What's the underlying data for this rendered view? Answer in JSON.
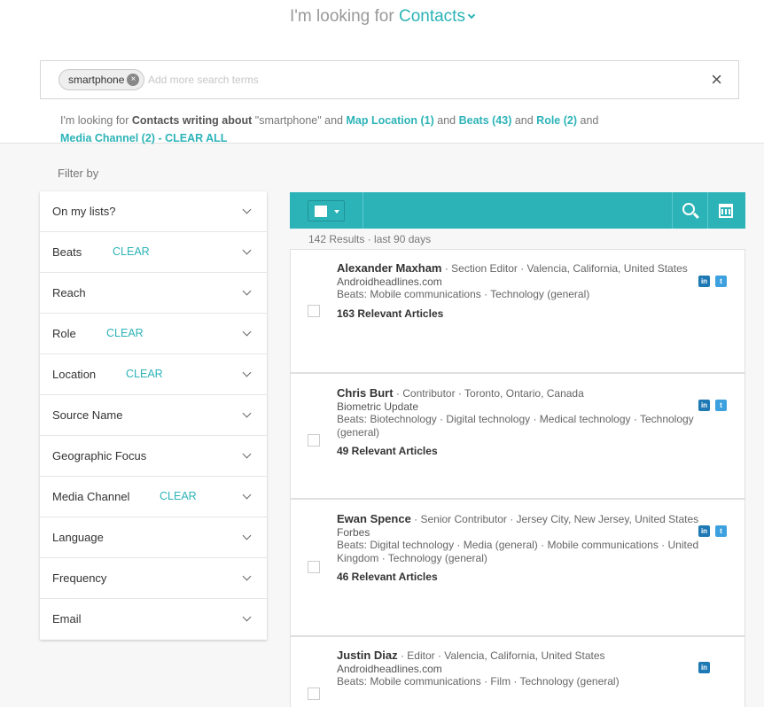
{
  "header": {
    "prefix": "I'm looking for",
    "type": "Contacts"
  },
  "search": {
    "chip": "smartphone",
    "placeholder": "Add more search terms"
  },
  "summary": {
    "t1": "I'm looking for ",
    "t2": "Contacts writing about",
    "t3": " \"smartphone\" and ",
    "l1": "Map Location (1)",
    "t4": " and ",
    "l2": "Beats (43)",
    "t5": " and ",
    "l3": "Role (2)",
    "t6": " and",
    "l4": "Media Channel (2)",
    "t7": " - ",
    "l5": "CLEAR ALL"
  },
  "filter_by": "Filter by",
  "clear_label": "CLEAR",
  "filters": [
    {
      "label": "On my lists?"
    },
    {
      "label": "Beats",
      "clear": true
    },
    {
      "label": "Reach"
    },
    {
      "label": "Role",
      "clear": true
    },
    {
      "label": "Location",
      "clear": true
    },
    {
      "label": "Source Name"
    },
    {
      "label": "Geographic Focus"
    },
    {
      "label": "Media Channel",
      "clear": true
    },
    {
      "label": "Language"
    },
    {
      "label": "Frequency"
    },
    {
      "label": "Email"
    }
  ],
  "results": {
    "count": "142 Results · last 90 days",
    "items": [
      {
        "name": "Alexander Maxham",
        "meta": " · Section Editor · Valencia, California, United States",
        "outlet": "Androidheadlines.com",
        "beats": "Beats: Mobile communications · Technology (general)",
        "articles": "163 Relevant Articles",
        "social": [
          "linkedin",
          "twitter"
        ]
      },
      {
        "name": "Chris Burt",
        "meta": " · Contributor · Toronto, Ontario, Canada",
        "outlet": "Biometric Update",
        "beats": "Beats: Biotechnology · Digital technology · Medical technology · Technology (general)",
        "articles": "49 Relevant Articles",
        "social": [
          "linkedin",
          "twitter"
        ]
      },
      {
        "name": "Ewan Spence",
        "meta": " · Senior Contributor · Jersey City, New Jersey, United States",
        "outlet": "Forbes",
        "beats": "Beats: Digital technology · Media (general) · Mobile communications · United Kingdom · Technology (general)",
        "articles": "46 Relevant Articles",
        "social": [
          "linkedin",
          "twitter"
        ]
      },
      {
        "name": "Justin Diaz",
        "meta": " · Editor · Valencia, California, United States",
        "outlet": "Androidheadlines.com",
        "beats": "Beats: Mobile communications · Film · Technology (general)",
        "articles": "",
        "social": [
          "linkedin"
        ]
      }
    ]
  },
  "colors": {
    "accent": "#2cb3b7",
    "linkedin": "#1f79b4",
    "twitter": "#3ea1df"
  }
}
